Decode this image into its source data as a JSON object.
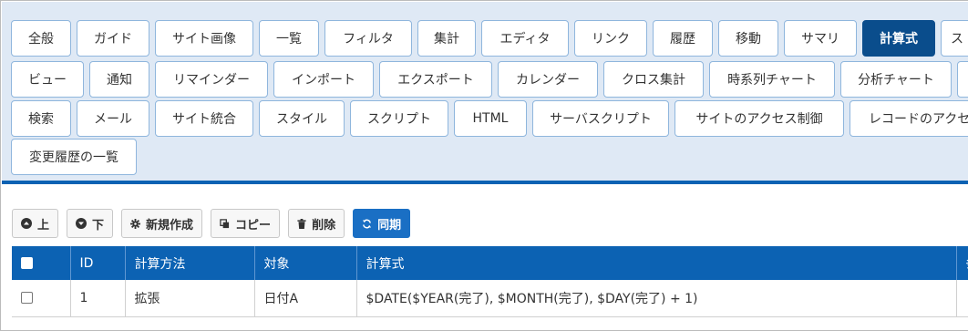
{
  "tabs": {
    "row1": [
      {
        "label": "全般"
      },
      {
        "label": "ガイド"
      },
      {
        "label": "サイト画像"
      },
      {
        "label": "一覧"
      },
      {
        "label": "フィルタ"
      },
      {
        "label": "集計"
      },
      {
        "label": "エディタ"
      },
      {
        "label": "リンク"
      },
      {
        "label": "履歴"
      },
      {
        "label": "移動"
      },
      {
        "label": "サマリ"
      },
      {
        "label": "計算式",
        "active": true
      },
      {
        "label": "ス"
      }
    ],
    "row2": [
      {
        "label": "ビュー"
      },
      {
        "label": "通知"
      },
      {
        "label": "リマインダー"
      },
      {
        "label": "インポート"
      },
      {
        "label": "エクスポート"
      },
      {
        "label": "カレンダー"
      },
      {
        "label": "クロス集計"
      },
      {
        "label": "時系列チャート"
      },
      {
        "label": "分析チャート"
      },
      {
        "label": ""
      }
    ],
    "row3": [
      {
        "label": "検索"
      },
      {
        "label": "メール"
      },
      {
        "label": "サイト統合"
      },
      {
        "label": "スタイル"
      },
      {
        "label": "スクリプト"
      },
      {
        "label": "HTML"
      },
      {
        "label": "サーバスクリプト"
      },
      {
        "label": "サイトのアクセス制御"
      },
      {
        "label": "レコードのアクセ"
      }
    ],
    "row4": [
      {
        "label": "変更履歴の一覧"
      }
    ]
  },
  "toolbar": {
    "up_label": "上",
    "down_label": "下",
    "new_label": "新規作成",
    "copy_label": "コピー",
    "delete_label": "削除",
    "sync_label": "同期"
  },
  "table": {
    "headers": {
      "id": "ID",
      "method": "計算方法",
      "target": "対象",
      "formula": "計算式",
      "extra": "条"
    },
    "rows": [
      {
        "id": "1",
        "method": "拡張",
        "target": "日付A",
        "formula": "$DATE($YEAR(完了), $MONTH(完了), $DAY(完了) + 1)"
      }
    ]
  },
  "colors": {
    "tabs_background": "#dfe9f5",
    "active_tab": "#0a4d8c",
    "header_blue": "#0c62b3",
    "sync_button": "#1a6fc4"
  }
}
